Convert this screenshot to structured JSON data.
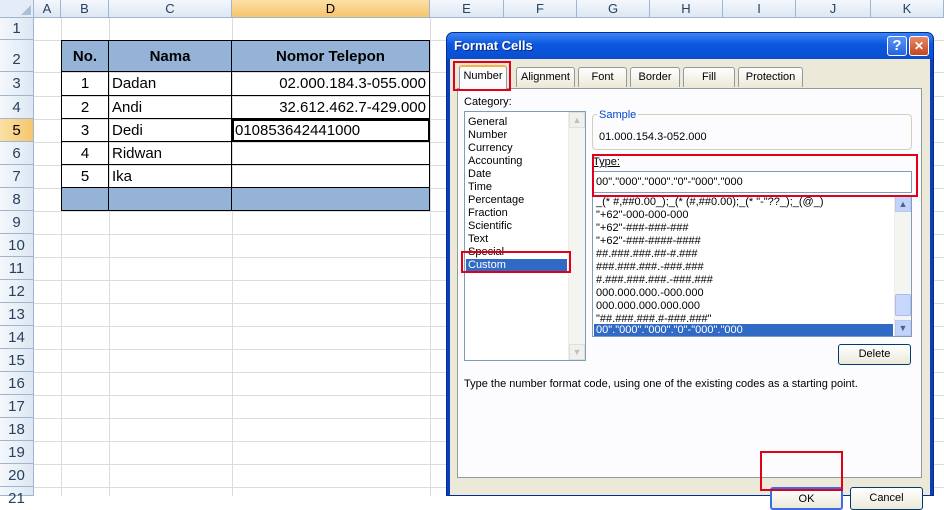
{
  "sheet": {
    "columns": [
      "A",
      "B",
      "C",
      "D",
      "E",
      "F",
      "G",
      "H",
      "I",
      "J",
      "K"
    ],
    "rows": [
      "1",
      "2",
      "3",
      "4",
      "5",
      "6",
      "7",
      "8",
      "9",
      "10",
      "11",
      "12",
      "13",
      "14",
      "15",
      "16",
      "17",
      "18",
      "19",
      "20",
      "21"
    ],
    "table": {
      "headers": {
        "no": "No.",
        "nama": "Nama",
        "telepon": "Nomor Telepon"
      },
      "records": [
        {
          "no": "1",
          "nama": "Dadan",
          "telepon": "02.000.184.3-055.000"
        },
        {
          "no": "2",
          "nama": "Andi",
          "telepon": "32.612.462.7-429.000"
        },
        {
          "no": "3",
          "nama": "Dedi",
          "telepon": "010853642441000"
        },
        {
          "no": "4",
          "nama": "Ridwan",
          "telepon": ""
        },
        {
          "no": "5",
          "nama": "Ika",
          "telepon": ""
        }
      ]
    }
  },
  "dialog": {
    "title": "Format Cells",
    "help_glyph": "?",
    "close_glyph": "✕",
    "tabs": [
      "Number",
      "Alignment",
      "Font",
      "Border",
      "Fill",
      "Protection"
    ],
    "category_label": "Category:",
    "categories": [
      "General",
      "Number",
      "Currency",
      "Accounting",
      "Date",
      "Time",
      "Percentage",
      "Fraction",
      "Scientific",
      "Text",
      "Special",
      "Custom"
    ],
    "selected_category": "Custom",
    "sample_label": "Sample",
    "sample_value": "01.000.154.3-052.000",
    "type_label": "Type:",
    "type_value": "00\".\"000\".\"000\".\"0\"-\"000\".\"000",
    "format_codes": [
      "_(* #,##0.00_);_(* (#,##0.00);_(* \"-\"??_);_(@_)",
      "\"+62\"-000-000-000",
      "\"+62\"-###-###-###",
      "\"+62\"-###-####-####",
      "##.###.###.##-#.###",
      "###.###.###.-###.###",
      "#.###.###.###.-###.###",
      "000.000.000.-000.000",
      "000.000.000.000.000",
      "\"##.###.###.#-###.###\"",
      "00\".\"000\".\"000\".\"0\"-\"000\".\"000"
    ],
    "delete_label": "Delete",
    "hint": "Type the number format code, using one of the existing codes as a starting point.",
    "ok_label": "OK",
    "cancel_label": "Cancel",
    "arrow_up": "▲",
    "arrow_down": "▼"
  }
}
